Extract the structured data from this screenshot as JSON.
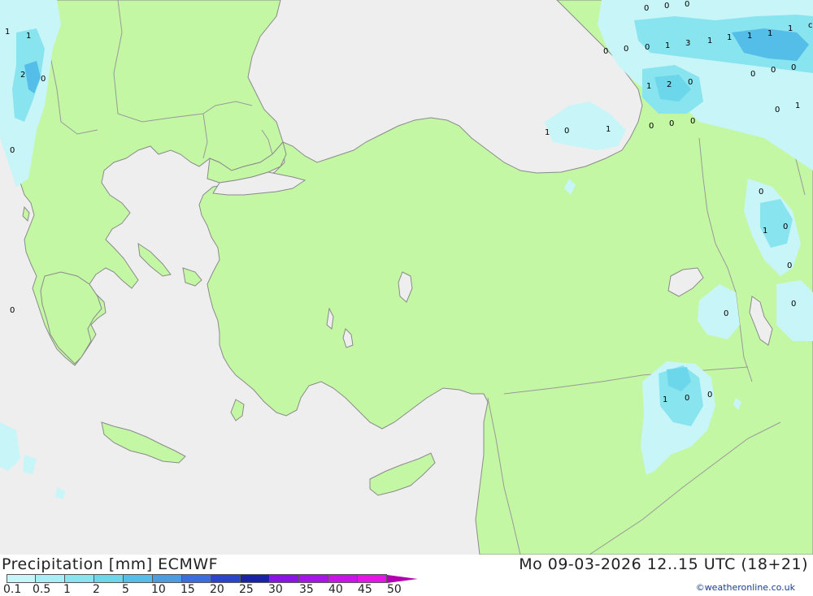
{
  "header": {
    "product": "Precipitation [mm] ECMWF",
    "valid_time": "Mo 09-03-2026 12..15 UTC (18+21)"
  },
  "colors": {
    "sea": "#eeeeee",
    "land": "#c4f7a4",
    "border": "#999999",
    "coast": "#8a8a8a"
  },
  "legend": {
    "labels": [
      "0.1",
      "0.5",
      "1",
      "2",
      "5",
      "10",
      "15",
      "20",
      "25",
      "30",
      "35",
      "40",
      "45",
      "50"
    ],
    "colors": [
      "#c8f5f8",
      "#a8eef4",
      "#88e4ef",
      "#6cd6ea",
      "#54bde8",
      "#4c9ce2",
      "#3a6ee0",
      "#2c44cc",
      "#1a23a8",
      "#8a14e6",
      "#a814e6",
      "#c814e6",
      "#e614e6",
      "#b000b0"
    ]
  },
  "map_labels": [
    {
      "text": "0"
    },
    {
      "text": "0"
    },
    {
      "text": "0"
    },
    {
      "text": "1"
    },
    {
      "text": "1"
    },
    {
      "text": "2"
    },
    {
      "text": "0"
    },
    {
      "text": "0"
    },
    {
      "text": "0"
    },
    {
      "text": "0"
    },
    {
      "text": "0"
    },
    {
      "text": "1"
    },
    {
      "text": "3"
    },
    {
      "text": "1"
    },
    {
      "text": "1"
    },
    {
      "text": "1"
    },
    {
      "text": "1"
    },
    {
      "text": "1"
    },
    {
      "text": "c"
    },
    {
      "text": "0"
    },
    {
      "text": "0"
    },
    {
      "text": "0"
    },
    {
      "text": "1"
    },
    {
      "text": "2"
    },
    {
      "text": "0"
    },
    {
      "text": "0"
    },
    {
      "text": "1"
    },
    {
      "text": "1"
    },
    {
      "text": "0"
    },
    {
      "text": "1"
    },
    {
      "text": "0"
    },
    {
      "text": "0"
    },
    {
      "text": "0"
    },
    {
      "text": "0"
    },
    {
      "text": "1"
    },
    {
      "text": "0"
    },
    {
      "text": "0"
    },
    {
      "text": "0"
    },
    {
      "text": "0"
    },
    {
      "text": "1"
    },
    {
      "text": "0"
    },
    {
      "text": "0"
    },
    {
      "text": "0"
    }
  ],
  "credit": "©weatheronline.co.uk"
}
